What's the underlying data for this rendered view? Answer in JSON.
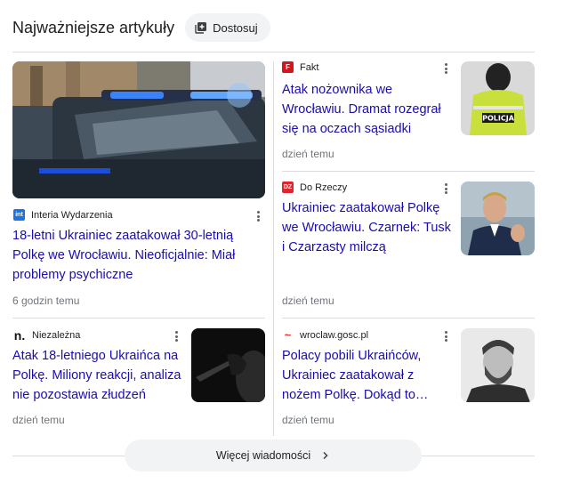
{
  "header": {
    "title": "Najważniejsze artykuły",
    "customize_label": "Dostosuj"
  },
  "articles": [
    {
      "source": "Interia Wydarzenia",
      "favicon_text": "int",
      "favicon_color": "#1a73e8",
      "headline": "18-letni Ukrainiec zaatakował 30-letnią Polkę we Wrocławiu. Nieoficjalnie: Miał problemy psychiczne",
      "time": "6 godzin temu",
      "image": "police-car"
    },
    {
      "source": "Fakt",
      "favicon_text": "F",
      "favicon_color": "#d7141a",
      "headline": "Atak nożownika we Wrocławiu. Dramat rozegrał się na oczach sąsiadki",
      "time": "dzień temu",
      "image": "policja-vest",
      "vest_text": "POLICJA"
    },
    {
      "source": "Do Rzeczy",
      "favicon_text": "DZ",
      "favicon_color": "#e0262d",
      "headline": "Ukrainiec zaatakował Polkę we Wrocławiu. Czarnek: Tusk i Czarzasty milczą",
      "time": "dzień temu",
      "image": "politician-portrait"
    },
    {
      "source": "Niezależna",
      "favicon_text": "n.",
      "favicon_color": "#111111",
      "headline": "Atak 18-letniego Ukraińca na Polkę. Miliony reakcji, analiza nie pozostawia złudzeń",
      "time": "dzień temu",
      "image": "knife-silhouette"
    },
    {
      "source": "wroclaw.gosc.pl",
      "favicon_text": "~",
      "favicon_color": "#e2322d",
      "headline": "Polacy pobili Ukraińców, Ukrainiec zaatakował z nożem Polkę. Dokąd to…",
      "time": "dzień temu",
      "image": "bearded-man-portrait"
    }
  ],
  "more_button": {
    "label": "Więcej wiadomości"
  }
}
